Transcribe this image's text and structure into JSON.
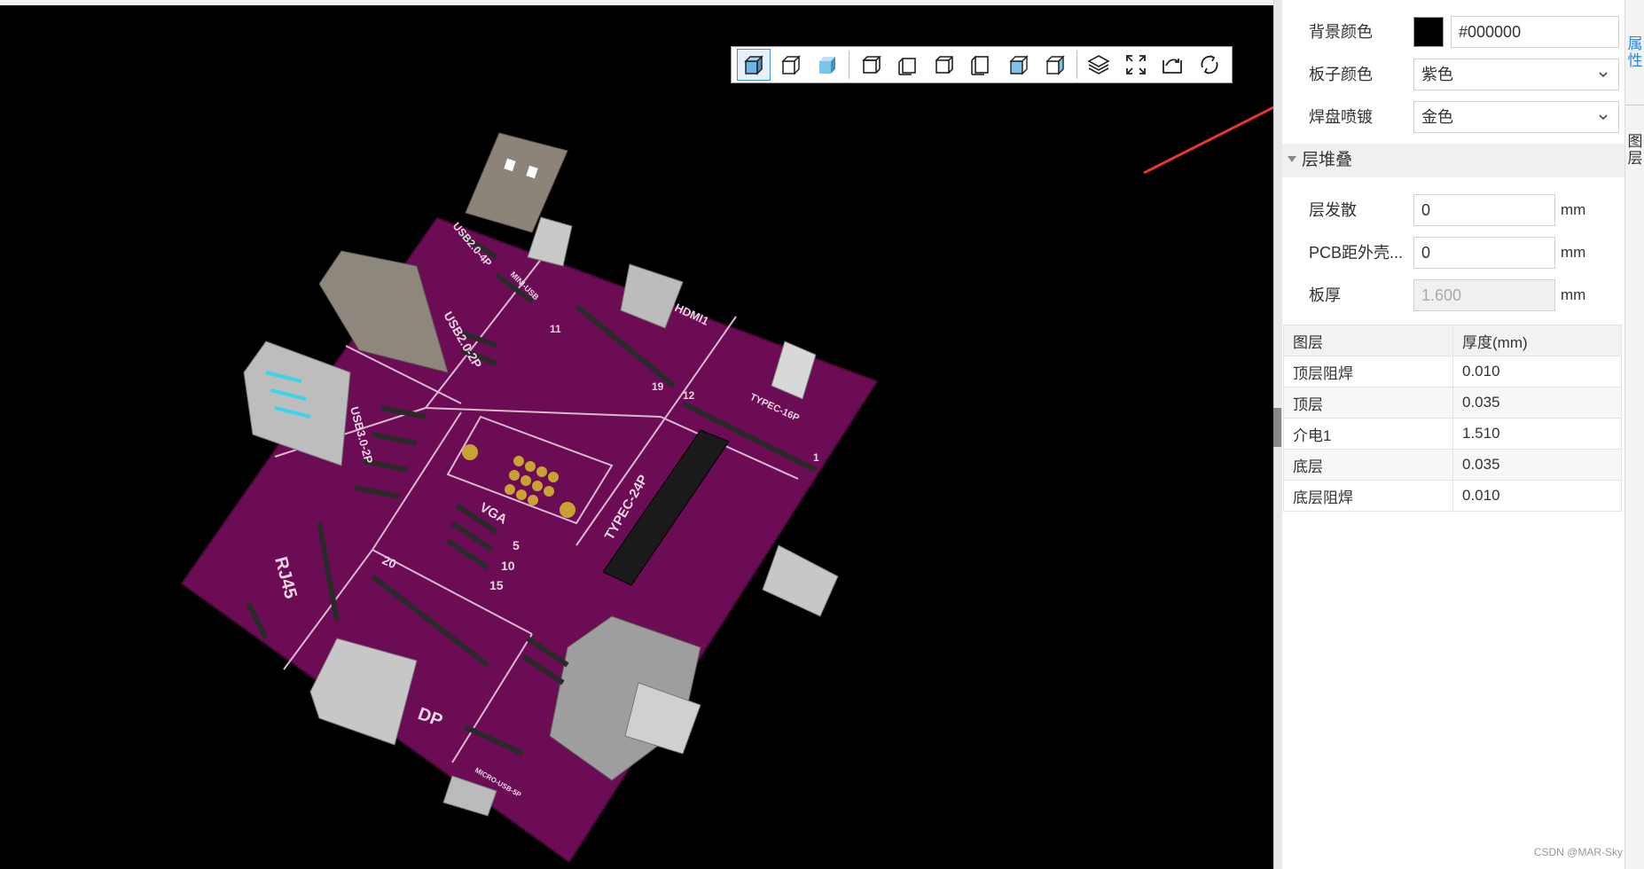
{
  "properties": {
    "background_color_label": "背景颜色",
    "background_color_value": "#000000",
    "board_color_label": "板子颜色",
    "board_color_value": "紫色",
    "pad_finish_label": "焊盘喷镀",
    "pad_finish_value": "金色"
  },
  "stackup": {
    "section_title": "层堆叠",
    "layer_spread_label": "层发散",
    "layer_spread_value": "0",
    "pcb_distance_label": "PCB距外壳...",
    "pcb_distance_value": "0",
    "board_thickness_label": "板厚",
    "board_thickness_value": "1.600",
    "unit": "mm"
  },
  "layer_table": {
    "headers": [
      "图层",
      "厚度(mm)"
    ],
    "rows": [
      {
        "layer": "顶层阻焊",
        "thickness": "0.010"
      },
      {
        "layer": "顶层",
        "thickness": "0.035"
      },
      {
        "layer": "介电1",
        "thickness": "1.510"
      },
      {
        "layer": "底层",
        "thickness": "0.035"
      },
      {
        "layer": "底层阻焊",
        "thickness": "0.010"
      }
    ]
  },
  "side_tabs": {
    "tab1": "属性",
    "tab2": "图层"
  },
  "board_labels": {
    "usb2_4p": "USB2.0-4P",
    "mini_usb": "MINI-USB",
    "usb2_2p": "USB2.0-2P",
    "hdmi": "HDMI1",
    "typec_16p": "TYPEC-16P",
    "usb3_2p": "USB3.0-2P",
    "vga": "VGA",
    "typec_24p": "TYPEC-24P",
    "rj45": "RJ45",
    "dp": "DP",
    "micro_usb": "MICRO-USB-5P",
    "pin_5": "5",
    "pin_10": "10",
    "pin_15": "15",
    "pin_20": "20",
    "pin_19": "19",
    "pin_1": "1",
    "pin_12": "12",
    "pin_11": "11"
  },
  "watermark": "CSDN @MAR-Sky",
  "colors": {
    "board": "#6b0c55",
    "viewport": "#000000",
    "arrow": "#e8362c",
    "accent": "#2f86d6"
  }
}
